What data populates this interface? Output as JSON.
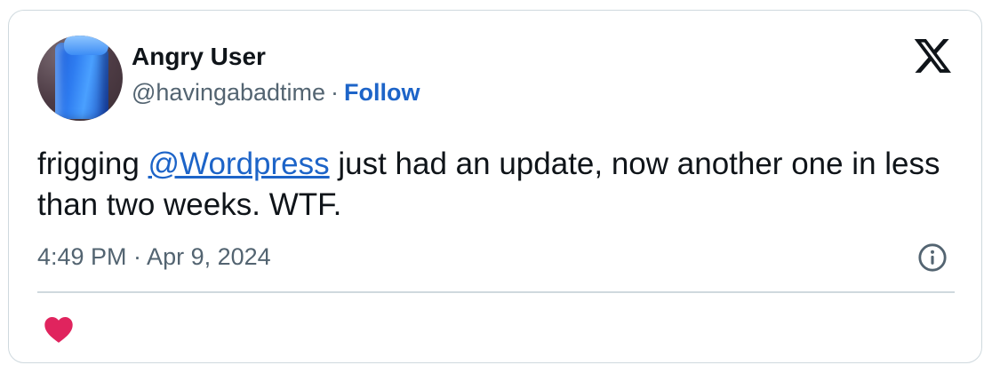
{
  "tweet": {
    "author": {
      "name": "Angry User",
      "handle": "@havingabadtime",
      "separator": "·",
      "follow_label": "Follow"
    },
    "text": {
      "before": "frigging ",
      "mention": "@Wordpress",
      "after": " just had an update, now another one in less than two weeks.  WTF."
    },
    "timestamp": "4:49 PM · Apr 9, 2024",
    "icons": {
      "brand": "x-logo-icon",
      "info": "info-icon",
      "like": "heart-icon"
    },
    "colors": {
      "link": "#1d64c8",
      "heart": "#e0245e",
      "muted": "#536471",
      "border": "#cfd9de"
    }
  }
}
